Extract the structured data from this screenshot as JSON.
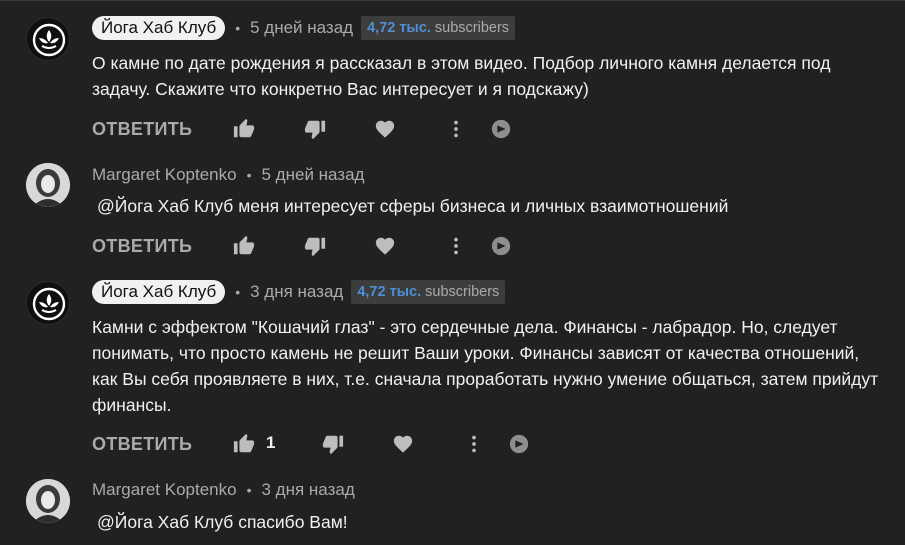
{
  "comments": [
    {
      "author": "Йога Хаб Клуб",
      "channel_owner": true,
      "time": "5 дней назад",
      "subscribers_count": "4,72 тыс.",
      "subscribers_label": "subscribers",
      "lines": [
        "О камне по дате рождения я рассказал в этом видео. Подбор личного камня делается под",
        "задачу. Скажите что конкретно Вас интересует и я подскажу)"
      ],
      "reply_label": "ОТВЕТИТЬ",
      "like_count": ""
    },
    {
      "author": "Margaret Koptenko",
      "channel_owner": false,
      "time": "5 дней назад",
      "lines": [
        "@Йога Хаб Клуб  меня интересует сферы бизнеса и личных взаимотношений"
      ],
      "reply_label": "ОТВЕТИТЬ",
      "like_count": ""
    },
    {
      "author": "Йога Хаб Клуб",
      "channel_owner": true,
      "time": "3 дня назад",
      "subscribers_count": "4,72 тыс.",
      "subscribers_label": "subscribers",
      "lines": [
        "Камни с эффектом \"Кошачий глаз\" - это сердечные дела. Финансы - лабрадор. Но, следует",
        "понимать, что просто камень не решит Ваши уроки. Финансы зависят от качества отношений,",
        "как Вы себя проявляете в них, т.е. сначала проработать нужно умение общаться, затем прийдут",
        "финансы."
      ],
      "reply_label": "ОТВЕТИТЬ",
      "like_count": "1"
    },
    {
      "author": "Margaret Koptenko",
      "channel_owner": false,
      "time": "3 дня назад",
      "lines": [
        "@Йога Хаб Клуб  спасибо Вам!"
      ]
    }
  ],
  "icons": {
    "like": "thumbs-up-icon",
    "dislike": "thumbs-down-icon",
    "heart": "heart-icon",
    "more": "more-vert-icon",
    "extension": "extension-badge-icon"
  },
  "colors": {
    "background": "#212121",
    "text": "#f1f1f1",
    "muted": "#aaaaaa",
    "subscribers_accent": "#4f8fd6"
  }
}
